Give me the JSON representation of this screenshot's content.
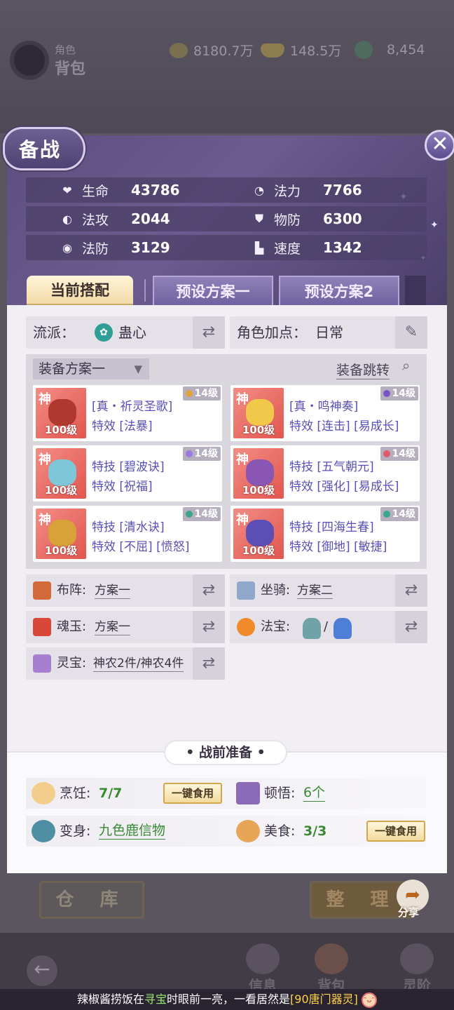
{
  "topbar": {
    "subtitle": "角色",
    "title": "背包",
    "currencies": [
      {
        "icon": "copper-coin-icon",
        "value": "8180.7万"
      },
      {
        "icon": "gold-ingot-icon",
        "value": "148.5万"
      },
      {
        "icon": "jade-icon",
        "value": "8,454"
      }
    ]
  },
  "modal": {
    "title": "备战",
    "close_label": "✕",
    "stats": [
      {
        "icon": "heart-icon",
        "label": "生命",
        "value": "43786"
      },
      {
        "icon": "mana-swirl-icon",
        "label": "法力",
        "value": "7766"
      },
      {
        "icon": "magic-attack-icon",
        "label": "法攻",
        "value": "2044"
      },
      {
        "icon": "armor-icon",
        "label": "物防",
        "value": "6300"
      },
      {
        "icon": "magic-defense-icon",
        "label": "法防",
        "value": "3129"
      },
      {
        "icon": "boot-icon",
        "label": "速度",
        "value": "1342"
      }
    ],
    "tabs": [
      "当前搭配",
      "预设方案一",
      "预设方案2"
    ],
    "school": {
      "label": "流派：",
      "value": "蛊心"
    },
    "points": {
      "label": "角色加点：",
      "value": "日常"
    },
    "equip": {
      "dropdown": "装备方案一",
      "jump": "装备跳转",
      "items": [
        {
          "grade": "神",
          "level": "100级",
          "badge": "14级",
          "line1": "[真・祈灵圣歌]",
          "line2": "特效 [法暴]",
          "gem": "#e0a23a",
          "art": "#b0392f"
        },
        {
          "grade": "神",
          "level": "100级",
          "badge": "14级",
          "line1": "[真・鸣神奏]",
          "line2": "特效 [连击] [易成长]",
          "gem": "#7a55c9",
          "art": "#f1c94a"
        },
        {
          "grade": "神",
          "level": "100级",
          "badge": "14级",
          "line1": "特技 [碧波诀]",
          "line2": "特效 [祝福]",
          "gem": "#9d7ae0",
          "art": "#7ec7d9"
        },
        {
          "grade": "神",
          "level": "100级",
          "badge": "14级",
          "line1": "特技 [五气朝元]",
          "line2": "特效 [强化] [易成长]",
          "gem": "#e05a6a",
          "art": "#8a56b3"
        },
        {
          "grade": "神",
          "level": "100级",
          "badge": "14级",
          "line1": "特技 [清水诀]",
          "line2": "特效 [不屈] [愤怒]",
          "gem": "#3aa58a",
          "art": "#d7a23a"
        },
        {
          "grade": "神",
          "level": "100级",
          "badge": "14级",
          "line1": "特技 [四海生春]",
          "line2": "特效 [御地] [敏捷]",
          "gem": "#3aa58a",
          "art": "#5b4fb5"
        }
      ]
    },
    "options": [
      {
        "label": "布阵:",
        "value": "方案一",
        "icon": "formation-icon"
      },
      {
        "label": "坐骑:",
        "value": "方案二",
        "icon": "mount-scroll-icon"
      },
      {
        "label": "魂玉:",
        "value": "方案一",
        "icon": "soul-jade-icon"
      },
      {
        "label": "法宝:",
        "value": "/",
        "icon": "fire-orb-icon"
      },
      {
        "label": "灵宝:",
        "value": "神农2件/神农4件",
        "icon": "spirit-treasure-icon"
      }
    ],
    "prep": {
      "title": "• 战前准备 •",
      "cooking": {
        "label": "烹饪:",
        "value": "7/7",
        "button": "一键食用"
      },
      "insight": {
        "label": "顿悟:",
        "value": "6个"
      },
      "transform": {
        "label": "变身:",
        "value": "九色鹿信物"
      },
      "food": {
        "label": "美食:",
        "value": "3/3",
        "button": "一键食用"
      }
    }
  },
  "background": {
    "store_button": "仓 库",
    "sort_button": "整 理",
    "share_label": "分享",
    "nav": [
      "信息",
      "背包",
      "灵阶"
    ]
  },
  "ticker": {
    "part1": "辣椒酱捞饭",
    "part2": "在",
    "part3": "寻宝",
    "part4": "时眼前一亮，一看居然是",
    "part5": "[90唐门器灵]"
  }
}
